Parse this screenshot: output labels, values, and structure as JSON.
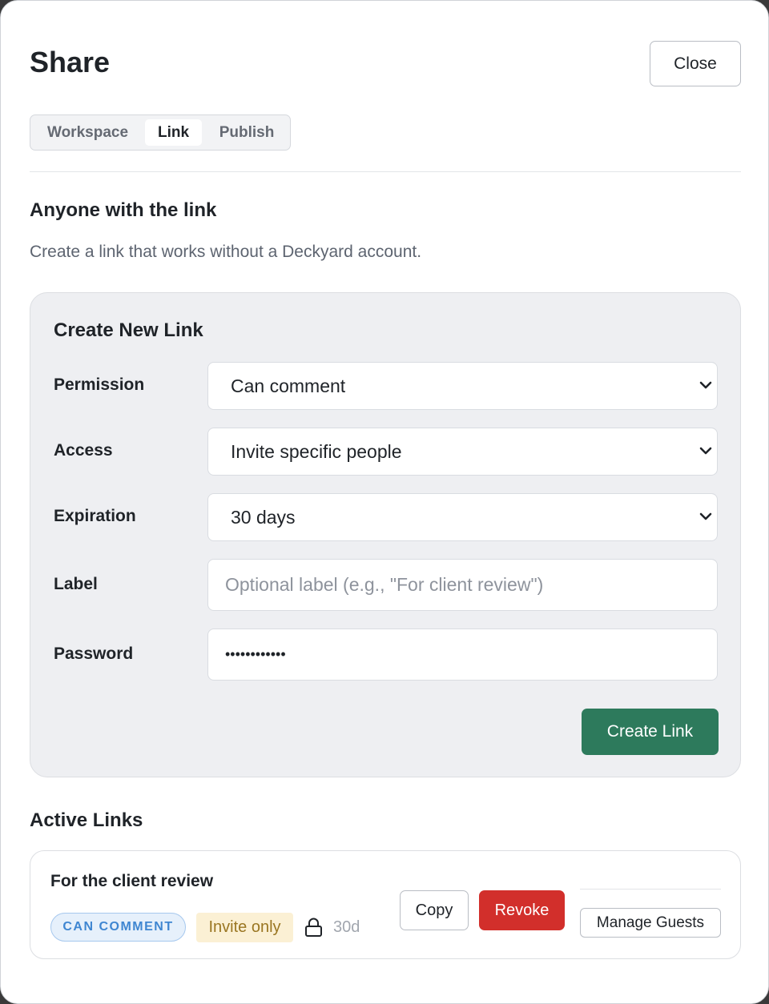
{
  "dialog": {
    "title": "Share",
    "close_label": "Close"
  },
  "tabs": [
    {
      "label": "Workspace",
      "active": false
    },
    {
      "label": "Link",
      "active": true
    },
    {
      "label": "Publish",
      "active": false
    }
  ],
  "section": {
    "heading": "Anyone with the link",
    "description": "Create a link that works without a Deckyard account."
  },
  "create_form": {
    "title": "Create New Link",
    "permission": {
      "label": "Permission",
      "value": "Can comment"
    },
    "access": {
      "label": "Access",
      "value": "Invite specific people"
    },
    "expiration": {
      "label": "Expiration",
      "value": "30 days"
    },
    "label_field": {
      "label": "Label",
      "placeholder": "Optional label (e.g., \"For client review\")"
    },
    "password": {
      "label": "Password",
      "value": "••••••••••••"
    },
    "submit_label": "Create Link"
  },
  "active_links": {
    "heading": "Active Links",
    "items": [
      {
        "name": "For the client review",
        "permission_badge": "CAN COMMENT",
        "access_badge": "Invite only",
        "expiry": "30d",
        "copy_label": "Copy",
        "revoke_label": "Revoke",
        "manage_label": "Manage Guests"
      }
    ]
  },
  "colors": {
    "primary_green": "#2d7a5c",
    "danger_red": "#d22f2b",
    "badge_blue": "#3f86d1",
    "badge_amber": "#9a7622"
  },
  "icons": [
    "chevron-down-icon",
    "lock-icon"
  ]
}
